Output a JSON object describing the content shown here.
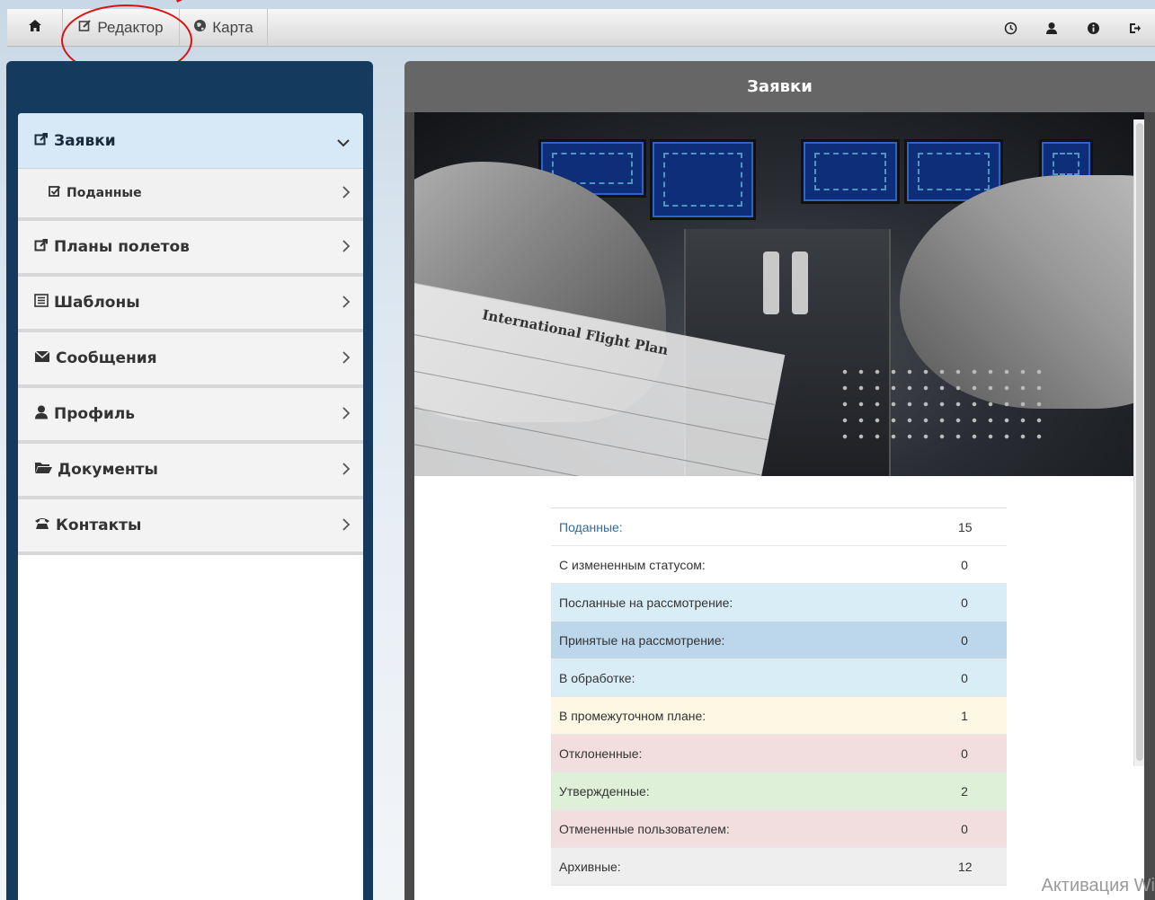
{
  "topbar": {
    "home_label": "",
    "editor_label": "Редактор",
    "map_label": "Карта",
    "icons": [
      "home-icon",
      "edit-icon",
      "globe-icon",
      "clock-icon",
      "user-icon",
      "info-icon",
      "logout-icon"
    ]
  },
  "sidebar": {
    "items": [
      {
        "label": "Заявки",
        "icon": "share-square-icon",
        "chevron": "⌄",
        "active": true
      },
      {
        "label": "Поданные",
        "icon": "check-square-icon",
        "chevron": "›",
        "sub": true
      },
      {
        "label": "Планы полетов",
        "icon": "share-square-icon",
        "chevron": "›"
      },
      {
        "label": "Шаблоны",
        "icon": "list-alt-icon",
        "chevron": "›"
      },
      {
        "label": "Сообщения",
        "icon": "envelope-icon",
        "chevron": "›"
      },
      {
        "label": "Профиль",
        "icon": "user-icon",
        "chevron": "›"
      },
      {
        "label": "Документы",
        "icon": "folder-open-icon",
        "chevron": "›"
      },
      {
        "label": "Контакты",
        "icon": "phone-alt-icon",
        "chevron": "›"
      }
    ]
  },
  "panel": {
    "title": "Заявки",
    "paper_title": "International Flight Plan"
  },
  "stats": [
    {
      "label": "Поданные:",
      "value": "15",
      "style": "link"
    },
    {
      "label": "С измененным статусом:",
      "value": "0",
      "style": ""
    },
    {
      "label": "Посланные на рассмотрение:",
      "value": "0",
      "style": "info"
    },
    {
      "label": "Принятые на рассмотрение:",
      "value": "0",
      "style": "active"
    },
    {
      "label": "В обработке:",
      "value": "0",
      "style": "info"
    },
    {
      "label": "В промежуточном плане:",
      "value": "1",
      "style": "warn"
    },
    {
      "label": "Отклоненные:",
      "value": "0",
      "style": "danger"
    },
    {
      "label": "Утвержденные:",
      "value": "2",
      "style": "success"
    },
    {
      "label": "Отмененные пользователем:",
      "value": "0",
      "style": "danger"
    },
    {
      "label": "Архивные:",
      "value": "12",
      "style": "gray"
    }
  ],
  "watermark": "Активация Wi",
  "colors": {
    "sidebar_bg": "#143a5e",
    "panel_header": "#666666",
    "active_item": "#d7e8f7",
    "annotation": "#dd1111"
  }
}
